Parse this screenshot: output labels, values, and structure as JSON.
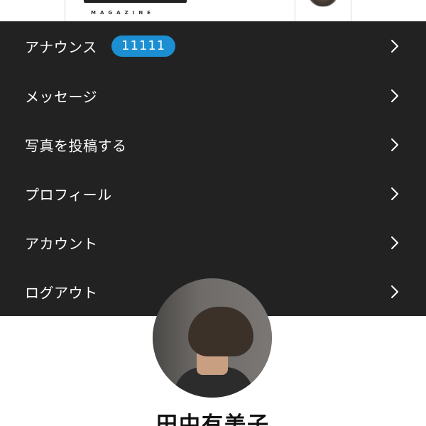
{
  "header": {
    "logo_sub": "MAGAZINE",
    "logo_alt": "Magazine logo",
    "avatar_alt": "User avatar"
  },
  "menu": {
    "items": [
      {
        "label": "アナウンス",
        "badge": "11111"
      },
      {
        "label": "メッセージ"
      },
      {
        "label": "写真を投稿する"
      },
      {
        "label": "プロフィール"
      },
      {
        "label": "アカウント"
      },
      {
        "label": "ログアウト"
      }
    ]
  },
  "profile": {
    "name": "田中有美子"
  },
  "colors": {
    "menu_bg": "#222222",
    "badge_bg": "#1b8fd1",
    "text_on_dark": "#ffffff"
  },
  "icons": {
    "menu_chevron": "chevron-right-icon"
  }
}
